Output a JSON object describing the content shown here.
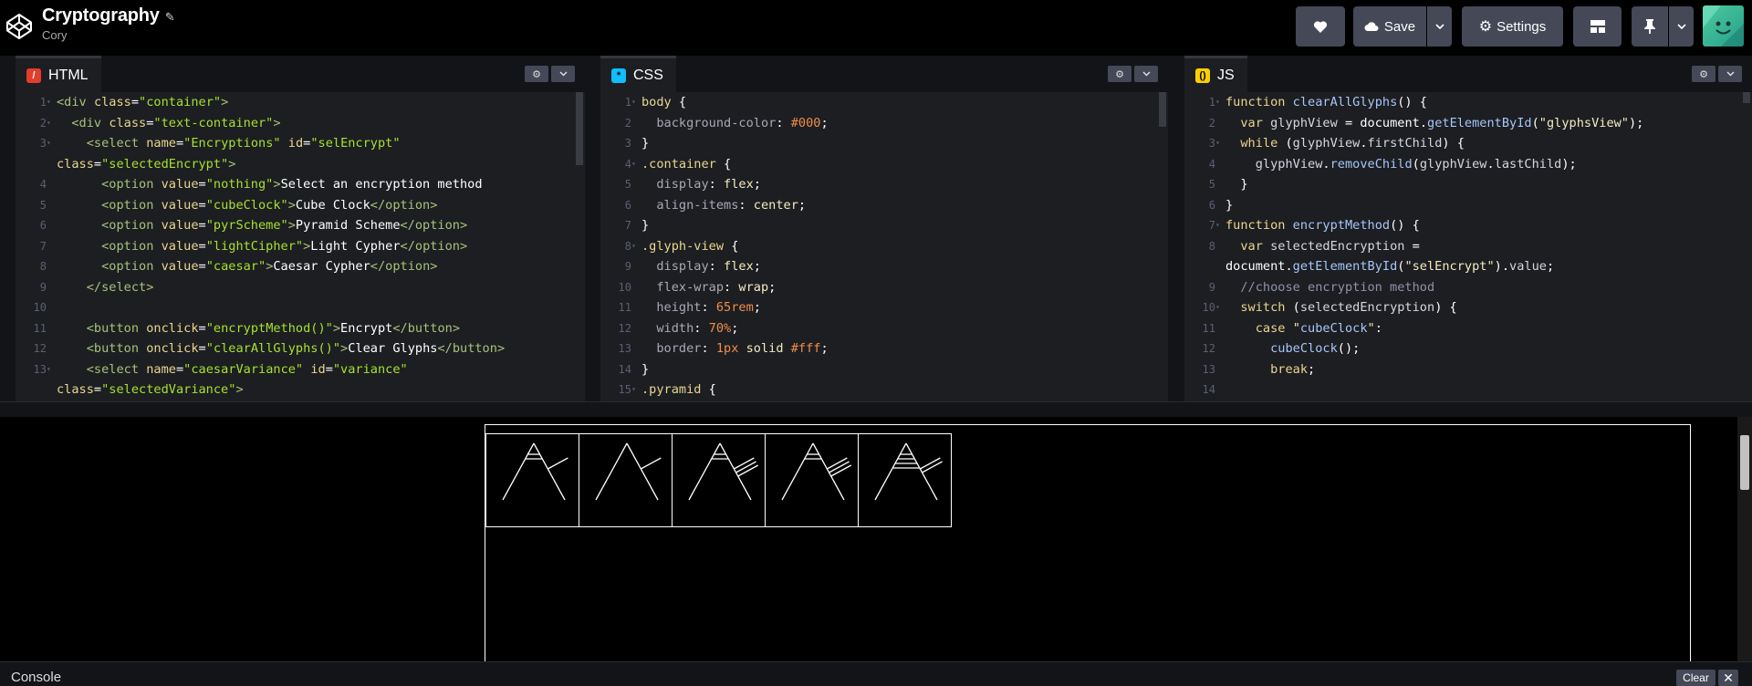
{
  "header": {
    "title": "Cryptography",
    "author": "Cory",
    "save_label": "Save",
    "settings_label": "Settings"
  },
  "panes": {
    "html": {
      "label": "HTML"
    },
    "css": {
      "label": "CSS"
    },
    "js": {
      "label": "JS"
    }
  },
  "html_code": [
    {
      "n": "1",
      "fold": true,
      "text": "<div class=\"container\">"
    },
    {
      "n": "2",
      "fold": true,
      "text": "  <div class=\"text-container\">"
    },
    {
      "n": "3",
      "fold": true,
      "text": "    <select name=\"Encryptions\" id=\"selEncrypt\""
    },
    {
      "n": "",
      "fold": false,
      "text": "class=\"selectedEncrypt\">"
    },
    {
      "n": "4",
      "fold": false,
      "text": "      <option value=\"nothing\">Select an encryption method"
    },
    {
      "n": "5",
      "fold": false,
      "text": "      <option value=\"cubeClock\">Cube Clock</option>"
    },
    {
      "n": "6",
      "fold": false,
      "text": "      <option value=\"pyrScheme\">Pyramid Scheme</option>"
    },
    {
      "n": "7",
      "fold": false,
      "text": "      <option value=\"lightCipher\">Light Cypher</option>"
    },
    {
      "n": "8",
      "fold": false,
      "text": "      <option value=\"caesar\">Caesar Cypher</option>"
    },
    {
      "n": "9",
      "fold": false,
      "text": "    </select>"
    },
    {
      "n": "10",
      "fold": false,
      "text": ""
    },
    {
      "n": "11",
      "fold": false,
      "text": "    <button onclick=\"encryptMethod()\">Encrypt</button>"
    },
    {
      "n": "12",
      "fold": false,
      "text": "    <button onclick=\"clearAllGlyphs()\">Clear Glyphs</button>"
    },
    {
      "n": "13",
      "fold": true,
      "text": "    <select name=\"caesarVariance\" id=\"variance\""
    },
    {
      "n": "",
      "fold": false,
      "text": "class=\"selectedVariance\">"
    }
  ],
  "css_code": [
    {
      "n": "1",
      "fold": true,
      "text": "body {"
    },
    {
      "n": "2",
      "fold": false,
      "text": "  background-color: #000;"
    },
    {
      "n": "3",
      "fold": false,
      "text": "}"
    },
    {
      "n": "4",
      "fold": true,
      "text": ".container {"
    },
    {
      "n": "5",
      "fold": false,
      "text": "  display: flex;"
    },
    {
      "n": "6",
      "fold": false,
      "text": "  align-items: center;"
    },
    {
      "n": "7",
      "fold": false,
      "text": "}"
    },
    {
      "n": "8",
      "fold": true,
      "text": ".glyph-view {"
    },
    {
      "n": "9",
      "fold": false,
      "text": "  display: flex;"
    },
    {
      "n": "10",
      "fold": false,
      "text": "  flex-wrap: wrap;"
    },
    {
      "n": "11",
      "fold": false,
      "text": "  height: 65rem;"
    },
    {
      "n": "12",
      "fold": false,
      "text": "  width: 70%;"
    },
    {
      "n": "13",
      "fold": false,
      "text": "  border: 1px solid #fff;"
    },
    {
      "n": "14",
      "fold": false,
      "text": "}"
    },
    {
      "n": "15",
      "fold": true,
      "text": ".pyramid {"
    }
  ],
  "js_code": [
    {
      "n": "1",
      "fold": true,
      "text": "function clearAllGlyphs() {"
    },
    {
      "n": "2",
      "fold": false,
      "text": "  var glyphView = document.getElementById(\"glyphsView\");"
    },
    {
      "n": "3",
      "fold": true,
      "text": "  while (glyphView.firstChild) {"
    },
    {
      "n": "4",
      "fold": false,
      "text": "    glyphView.removeChild(glyphView.lastChild);"
    },
    {
      "n": "5",
      "fold": false,
      "text": "  }"
    },
    {
      "n": "6",
      "fold": false,
      "text": "}"
    },
    {
      "n": "7",
      "fold": true,
      "text": "function encryptMethod() {"
    },
    {
      "n": "8",
      "fold": false,
      "text": "  var selectedEncryption ="
    },
    {
      "n": "",
      "fold": false,
      "text": "document.getElementById(\"selEncrypt\").value;"
    },
    {
      "n": "9",
      "fold": false,
      "text": "  //choose encryption method"
    },
    {
      "n": "10",
      "fold": true,
      "text": "  switch (selectedEncryption) {"
    },
    {
      "n": "11",
      "fold": false,
      "text": "    case \"cubeClock\":"
    },
    {
      "n": "12",
      "fold": false,
      "text": "      cubeClock();"
    },
    {
      "n": "13",
      "fold": false,
      "text": "      break;"
    },
    {
      "n": "14",
      "fold": false,
      "text": ""
    }
  ],
  "glyphs": [
    {
      "name": "glyph-1",
      "bars": 2,
      "ticks": 1
    },
    {
      "name": "glyph-2",
      "bars": 0,
      "ticks": 1
    },
    {
      "name": "glyph-3",
      "bars": 2,
      "ticks": 3
    },
    {
      "name": "glyph-4",
      "bars": 2,
      "ticks": 3
    },
    {
      "name": "glyph-5",
      "bars": 4,
      "ticks": 2
    }
  ],
  "console": {
    "label": "Console",
    "clear_label": "Clear"
  },
  "colors": {
    "html_icon": "#e23e2b",
    "css_icon": "#0ebeff",
    "js_icon": "#fcd000"
  }
}
